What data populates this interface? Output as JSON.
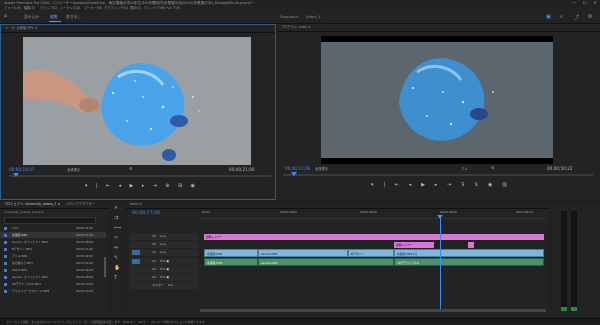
{
  "titlebar": {
    "title": "Adobe Premiere Pro 2020 - C:\\ユーザー\\hudson\\OneDrive - 東京電機大学\\4年生\\3D\\卒業制作\\卒業展示用\\2020\\卒業展示3D_Design\\Movie.prproj *",
    "controls": [
      "—",
      "☐",
      "✕"
    ]
  },
  "menubar": {
    "items": [
      "ファイル(F)",
      "編集(E)",
      "クリップ(C)",
      "シーケンス(S)",
      "マーカー(M)",
      "グラフィック(G)",
      "表示(V)",
      "ウィンドウ(W)",
      "ヘルプ(H)"
    ]
  },
  "workspace": {
    "tabs": [
      "読み込み",
      "編集",
      "書き出し"
    ],
    "active_index": 1,
    "extra_tabs": [
      "Sequence",
      "Video_1"
    ]
  },
  "source_monitor": {
    "header": "ソース: 水風船.MP4 ≡",
    "tc_left": "00;00;18;07",
    "fit_label": "全体表示",
    "tc_right": "00;00;21;00"
  },
  "program_monitor": {
    "header": "プログラム: main ≡",
    "tc_left": "00;00;17;06",
    "fit_label": "全体表示",
    "tc_right": "00;00;50;22",
    "quality_label": "フル"
  },
  "project_panel": {
    "header": "プロジェクト: university_videos_1 ≡",
    "header2": "メディアブラウザー",
    "path_label": "university_videos_1.prproj",
    "items": [
      {
        "name": "main",
        "dur": "00;00;45;00"
      },
      {
        "name": "水風船.MP4",
        "dur": "00;00;21;00"
      },
      {
        "name": "Ascent...オブジェクト.MP4",
        "dur": "00;00;08;00"
      },
      {
        "name": "Bデザイン.MP4",
        "dur": "00;00;11;00"
      },
      {
        "name": "アニメ.MP4",
        "dur": "00;00;09;00"
      },
      {
        "name": "夏の終わり.MP4",
        "dur": "00;00;04;00"
      },
      {
        "name": "3DCG.MP4",
        "dur": "00;00;06;00"
      },
      {
        "name": "Ascent...オブジェクト.MP4",
        "dur": "00;00;08;00"
      },
      {
        "name": "3DモデリングCG.MP4",
        "dur": "00;00;10;00"
      },
      {
        "name": "テキストワークスペース.MP4",
        "dur": "00;00;03;00"
      }
    ]
  },
  "timeline": {
    "tab_label": "main ≡",
    "timecode": "00;00;17;06",
    "ruler_labels": [
      "00;00",
      "00;00;16;00",
      "00;00;32;00",
      "00;00;48;00",
      "00;01;04;02"
    ],
    "tracks": [
      {
        "name": "V3"
      },
      {
        "name": "V2"
      },
      {
        "name": "V1"
      },
      {
        "name": "A1"
      },
      {
        "name": "A2"
      },
      {
        "name": "A3"
      },
      {
        "name": "マスター"
      }
    ],
    "master_value": "0.0",
    "clip_labels": {
      "pink1": "調整レイヤー",
      "pink2": "調整レイヤー",
      "v_a": "水風船.MP4",
      "v_b": "Ascent.MP4",
      "v_c": "Bデザイン",
      "v_d": "水風船.MP4 [V]",
      "a_a": "水風船.MP4",
      "a_b": "Ascent.MP4",
      "a_c": "3DモデリングCG"
    }
  },
  "status_bar": {
    "text": "クリックして選択、または空のスペースでクリックしてドラッグして選択範囲を指定します。Shift キー、Alt キー、Ctrl キーで他のオプションを使用できます。"
  },
  "colors": {
    "accent": "#3a8fff",
    "video_clip": "#7db7dd",
    "audio_clip": "#4f8f6d",
    "adjustment_clip": "#d677d8",
    "playhead": "#3a8fff"
  }
}
